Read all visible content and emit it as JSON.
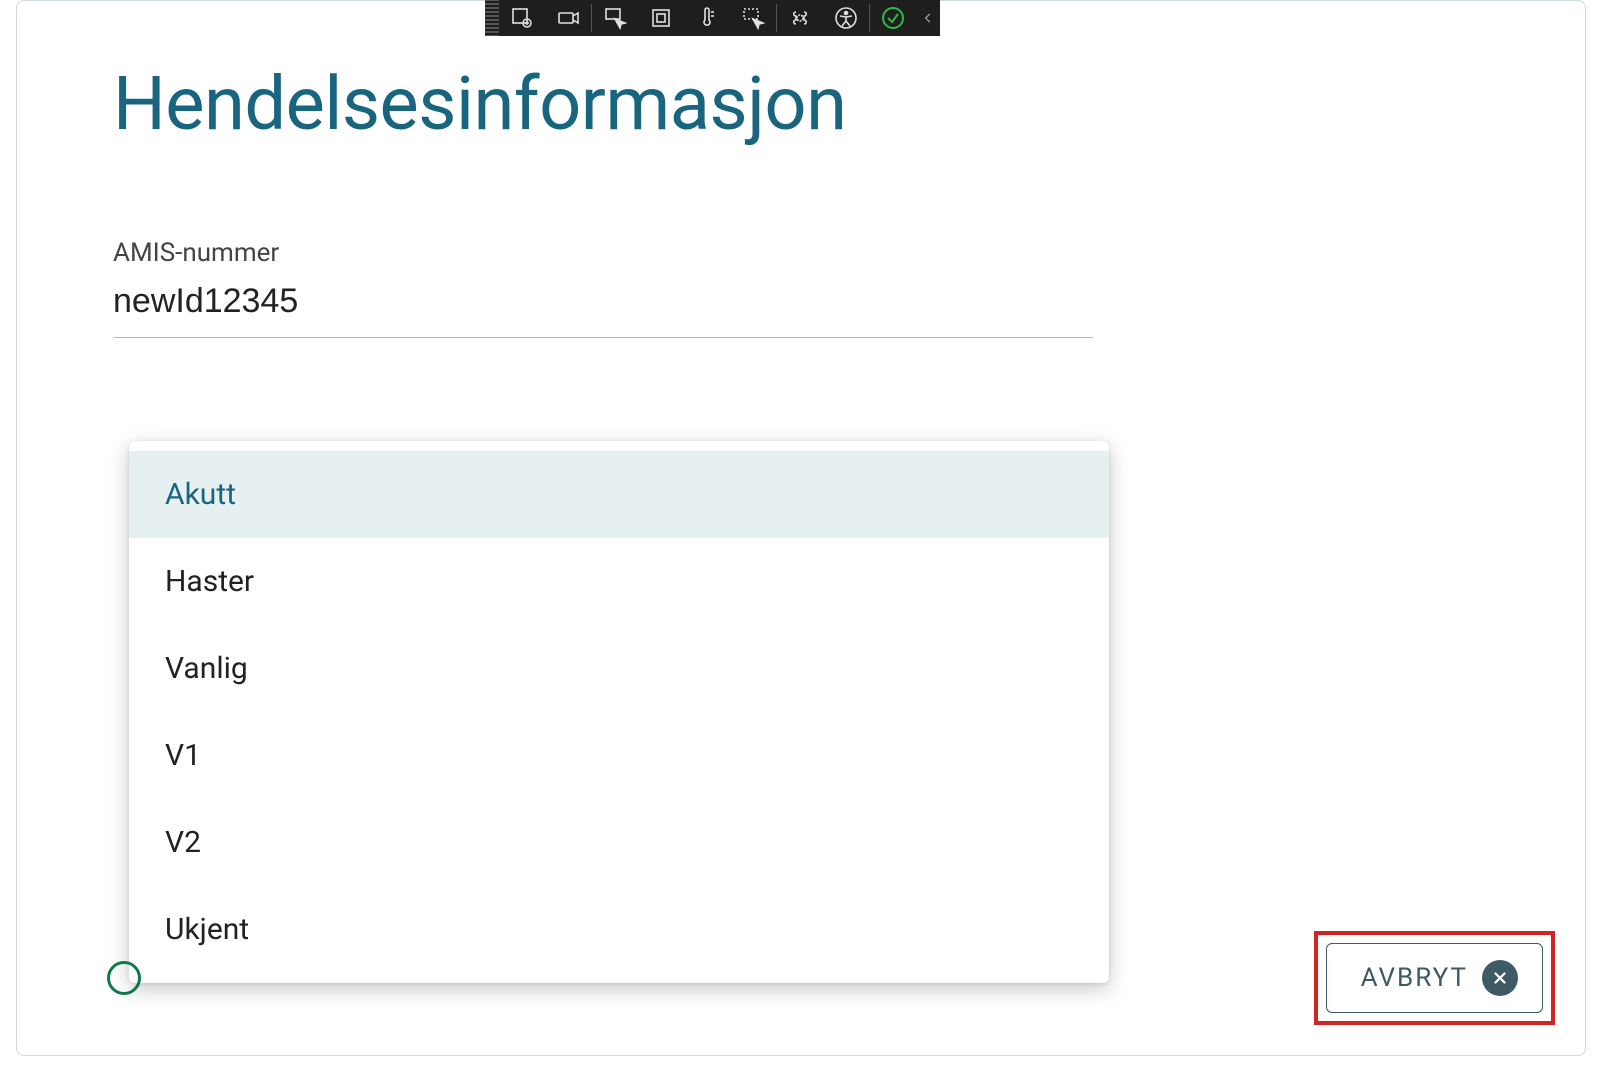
{
  "title": "Hendelsesinformasjon",
  "field": {
    "label": "AMIS-nummer",
    "value": "newId12345"
  },
  "dropdown": {
    "options": [
      "Akutt",
      "Haster",
      "Vanlig",
      "V1",
      "V2",
      "Ukjent"
    ],
    "active_index": 0
  },
  "buttons": {
    "cancel": "AVBRYT"
  },
  "toolbar": {
    "icons": [
      "inspect-icon",
      "camera-icon",
      "selector-icon",
      "responsive-icon",
      "thermometer-icon",
      "snapshot-icon",
      "state-icon",
      "accessibility-icon",
      "check-ok-icon"
    ]
  }
}
